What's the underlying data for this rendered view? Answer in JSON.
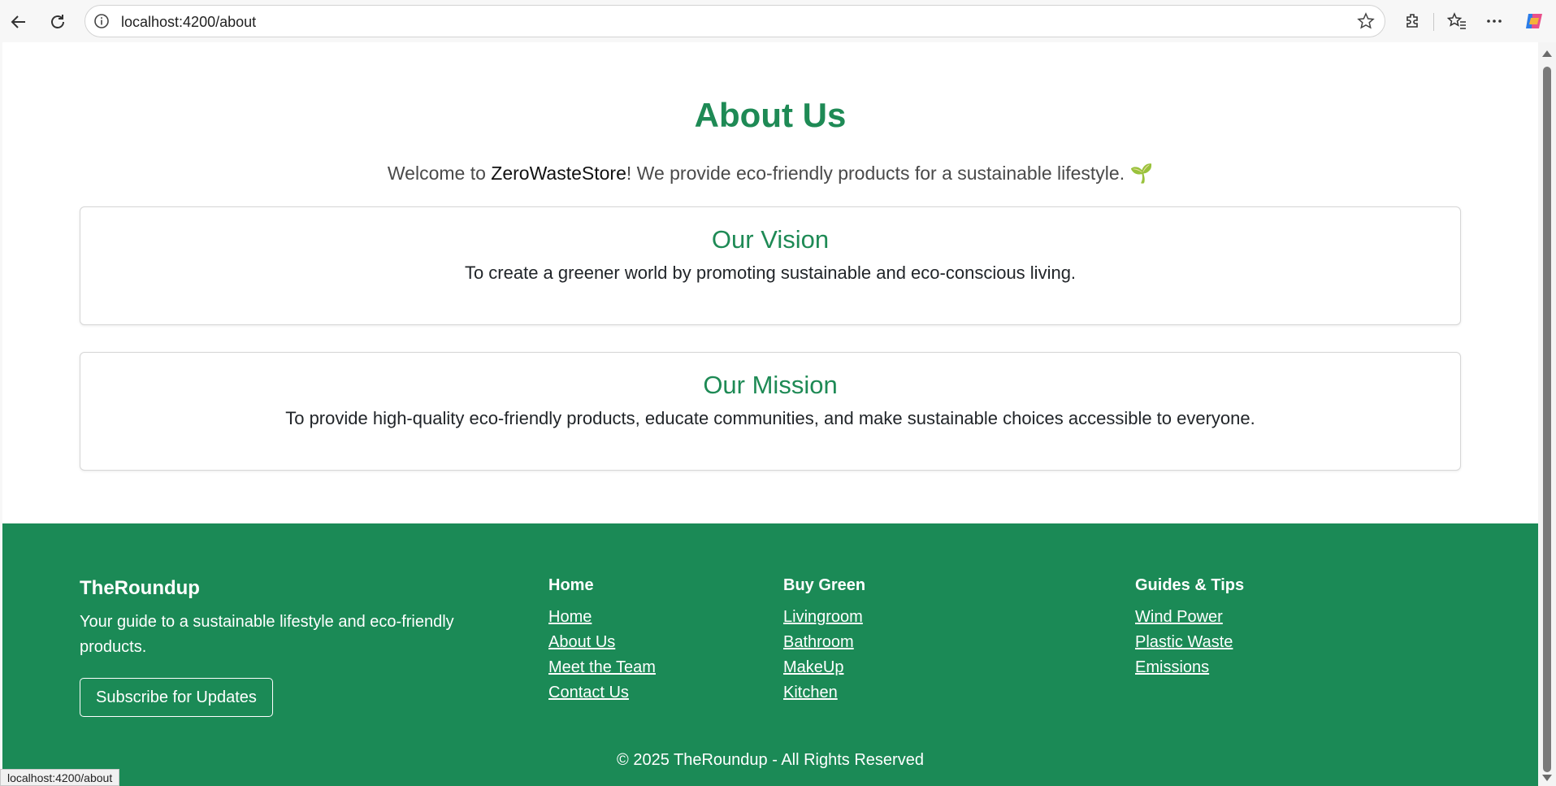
{
  "browser": {
    "url": "localhost:4200/about",
    "status_url": "localhost:4200/about"
  },
  "page": {
    "title": "About Us",
    "intro_before": "Welcome to ",
    "intro_brand": "ZeroWasteStore",
    "intro_after": "! We provide eco-friendly products for a sustainable lifestyle. 🌱",
    "vision": {
      "heading": "Our Vision",
      "text": "To create a greener world by promoting sustainable and eco-conscious living."
    },
    "mission": {
      "heading": "Our Mission",
      "text": "To provide high-quality eco-friendly products, educate communities, and make sustainable choices accessible to everyone."
    }
  },
  "footer": {
    "brand": "TheRoundup",
    "tagline": "Your guide to a sustainable lifestyle and eco-friendly products.",
    "subscribe_label": "Subscribe for Updates",
    "columns": [
      {
        "heading": "Home",
        "links": [
          "Home",
          "About Us",
          "Meet the Team",
          "Contact Us"
        ]
      },
      {
        "heading": "Buy Green",
        "links": [
          "Livingroom",
          "Bathroom",
          "MakeUp",
          "Kitchen"
        ]
      },
      {
        "heading": "Guides & Tips",
        "links": [
          "Wind Power",
          "Plastic Waste",
          "Emissions"
        ]
      }
    ],
    "copyright": "© 2025 TheRoundup - All Rights Reserved"
  },
  "colors": {
    "brand_green": "#1e8a55",
    "footer_bg": "#1b8a56"
  },
  "icons": [
    "back-arrow-icon",
    "refresh-icon",
    "info-icon",
    "star-icon",
    "extensions-icon",
    "favorites-icon",
    "more-icon",
    "copilot-icon"
  ]
}
